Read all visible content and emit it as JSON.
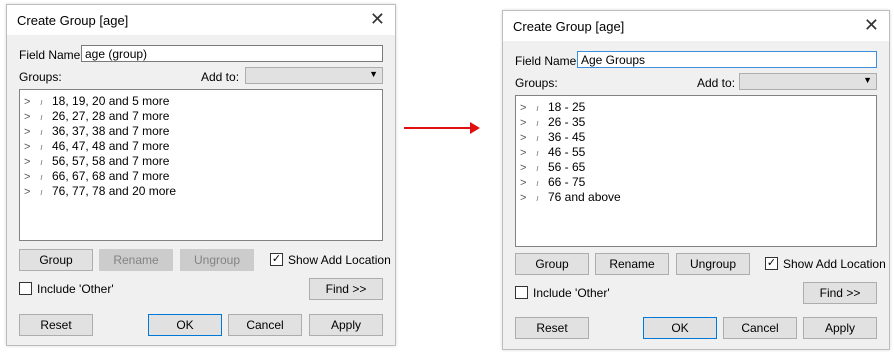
{
  "left_dialog": {
    "title": "Create Group [age]",
    "field_name_label": "Field Name:",
    "field_name_value": "age (group)",
    "groups_label": "Groups:",
    "add_to_label": "Add to:",
    "groups": [
      "18, 19, 20 and 5 more",
      "26, 27, 28 and 7 more",
      "36, 37, 38 and 7 more",
      "46, 47, 48 and 7 more",
      "56, 57, 58 and 7 more",
      "66, 67, 68 and 7 more",
      "76, 77, 78 and 20 more"
    ],
    "buttons": {
      "group": "Group",
      "rename": "Rename",
      "ungroup": "Ungroup",
      "find": "Find >>",
      "reset": "Reset",
      "ok": "OK",
      "cancel": "Cancel",
      "apply": "Apply"
    },
    "show_add_location_label": "Show Add Location",
    "show_add_location_checked": true,
    "include_other_label": "Include 'Other'",
    "include_other_checked": false
  },
  "right_dialog": {
    "title": "Create Group [age]",
    "field_name_label": "Field Name:",
    "field_name_value": "Age Groups",
    "groups_label": "Groups:",
    "add_to_label": "Add to:",
    "groups": [
      "18 - 25",
      "26 - 35",
      "36 - 45",
      "46 - 55",
      "56 - 65",
      "66 - 75",
      "76 and above"
    ],
    "buttons": {
      "group": "Group",
      "rename": "Rename",
      "ungroup": "Ungroup",
      "find": "Find >>",
      "reset": "Reset",
      "ok": "OK",
      "cancel": "Cancel",
      "apply": "Apply"
    },
    "show_add_location_label": "Show Add Location",
    "show_add_location_checked": true,
    "include_other_label": "Include 'Other'",
    "include_other_checked": false
  },
  "colors": {
    "arrow": "#e01010",
    "focus_border": "#3c8fdc",
    "default_button_border": "#0078d7"
  },
  "icons": {
    "close": "close-icon",
    "expand": "chevron-right-icon",
    "group": "paperclip-icon",
    "dropdown": "chevron-down-icon",
    "arrow": "arrow-right-icon"
  }
}
